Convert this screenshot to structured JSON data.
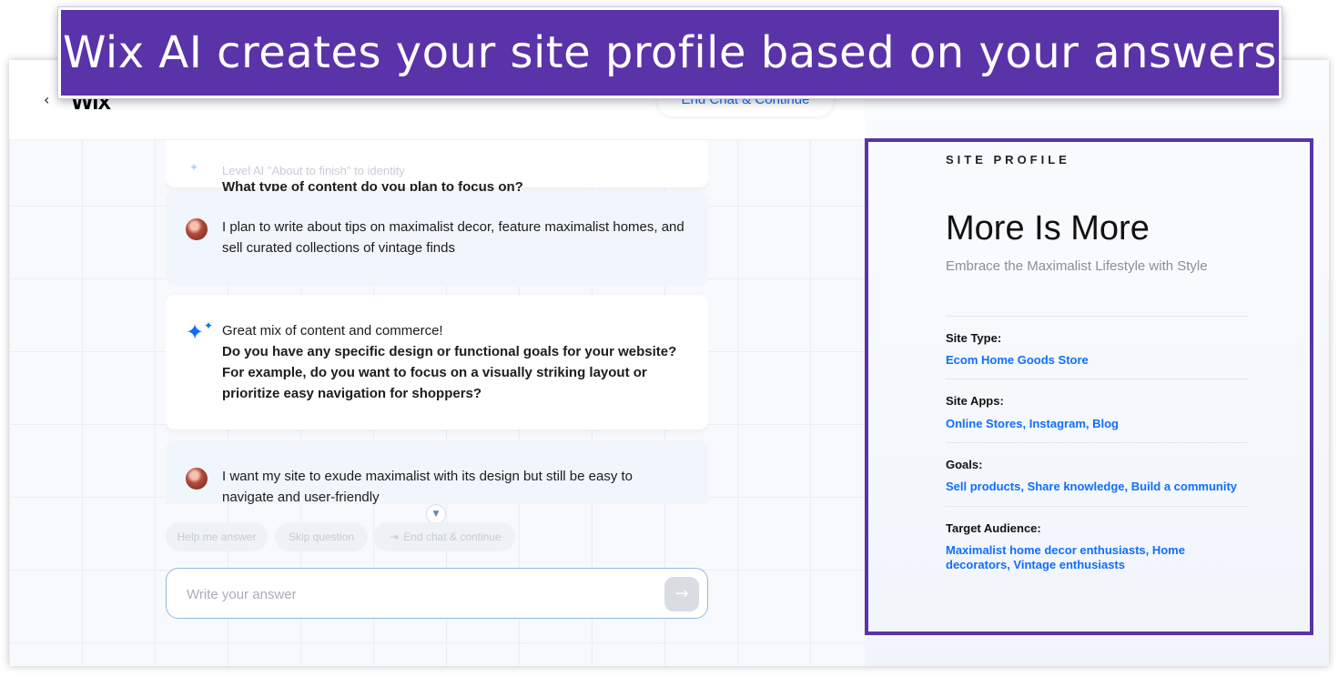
{
  "banner": {
    "text": "Wix AI creates your site profile based on your answers"
  },
  "topbar": {
    "back_icon": "chevron-left-icon",
    "logo": "Wix",
    "end_chat_label": "End Chat & Continue"
  },
  "chat": {
    "faded_line": "Level AI \"About to finish\" to identity",
    "messages": [
      {
        "role": "ai",
        "lines": [
          "What type of content do you plan to focus on?"
        ]
      },
      {
        "role": "user",
        "text": "I plan to write about tips on maximalist decor, feature maximalist homes, and sell curated collections of vintage finds"
      },
      {
        "role": "ai",
        "intro": "Great mix of content and commerce!",
        "question": "Do you have any specific design or functional goals for your website? For example, do you want to focus on a visually striking layout or prioritize easy navigation for shoppers?"
      },
      {
        "role": "user",
        "text": "I want my site to exude maximalist with its design but still be easy to navigate and user-friendly"
      }
    ]
  },
  "chips": {
    "help": "Help me answer",
    "skip": "Skip question",
    "end": "End chat & continue"
  },
  "answer": {
    "placeholder": "Write your answer"
  },
  "site_profile": {
    "label": "SITE PROFILE",
    "title": "More Is More",
    "subtitle": "Embrace the Maximalist Lifestyle with Style",
    "fields": [
      {
        "key": "Site Type:",
        "value": "Ecom Home Goods Store"
      },
      {
        "key": "Site Apps:",
        "value": "Online Stores, Instagram, Blog"
      },
      {
        "key": "Goals:",
        "value": "Sell products, Share knowledge, Build a community"
      },
      {
        "key": "Target Audience:",
        "value": "Maximalist home decor enthusiasts, Home decorators, Vintage enthusiasts"
      }
    ]
  },
  "colors": {
    "accent": "#116dff",
    "banner": "#5a33a9"
  }
}
